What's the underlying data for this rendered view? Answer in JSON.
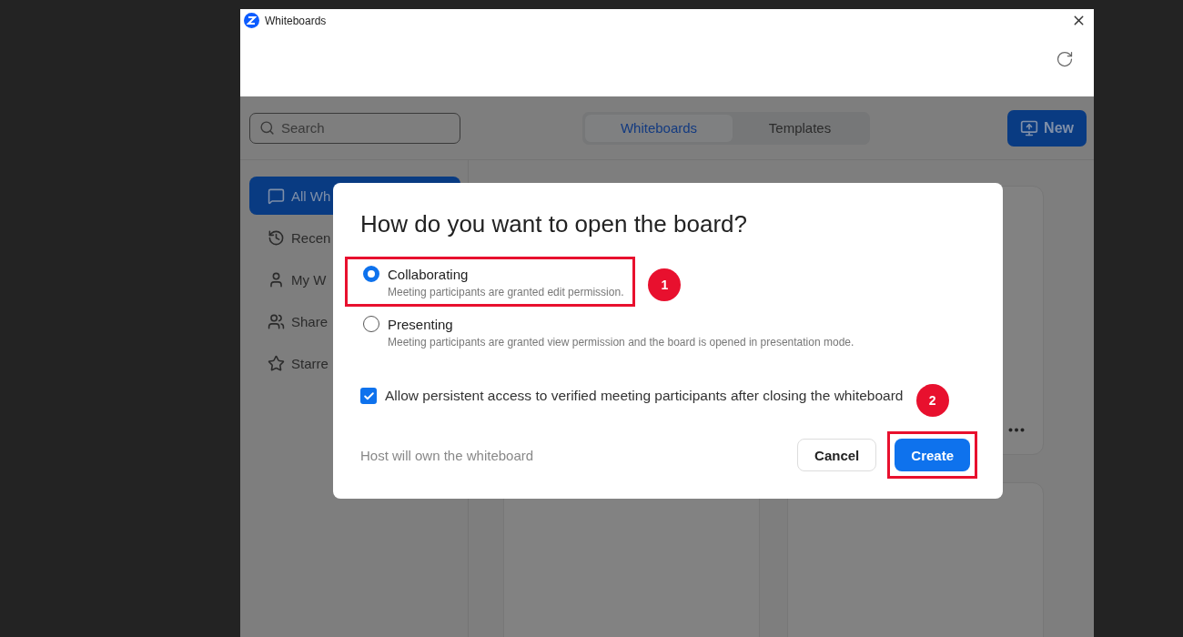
{
  "window": {
    "title": "Whiteboards"
  },
  "search": {
    "placeholder": "Search"
  },
  "tabs": [
    {
      "label": "Whiteboards",
      "selected": true
    },
    {
      "label": "Templates",
      "selected": false
    }
  ],
  "new_button": {
    "label": "New"
  },
  "sidebar": {
    "items": [
      {
        "label": "All Wh",
        "kind": "board",
        "selected": true
      },
      {
        "label": "Recen",
        "kind": "recent",
        "selected": false
      },
      {
        "label": "My W",
        "kind": "person",
        "selected": false
      },
      {
        "label": "Share",
        "kind": "people",
        "selected": false
      },
      {
        "label": "Starre",
        "kind": "star",
        "selected": false
      }
    ]
  },
  "dialog": {
    "title": "How do you want to open the board?",
    "options": [
      {
        "label": "Collaborating",
        "description": "Meeting participants are granted edit permission.",
        "selected": true,
        "highlighted": true,
        "badge": "1"
      },
      {
        "label": "Presenting",
        "description": "Meeting participants are granted view permission and the board is opened in presentation mode.",
        "selected": false,
        "highlighted": false
      }
    ],
    "checkbox": {
      "label": "Allow persistent access to verified meeting participants after closing the whiteboard",
      "checked": true
    },
    "footer_note": "Host will own the whiteboard",
    "buttons": [
      {
        "label": "Cancel",
        "kind": "secondary",
        "highlighted": false
      },
      {
        "label": "Create",
        "kind": "primary",
        "highlighted": true,
        "badge": "2"
      }
    ]
  }
}
